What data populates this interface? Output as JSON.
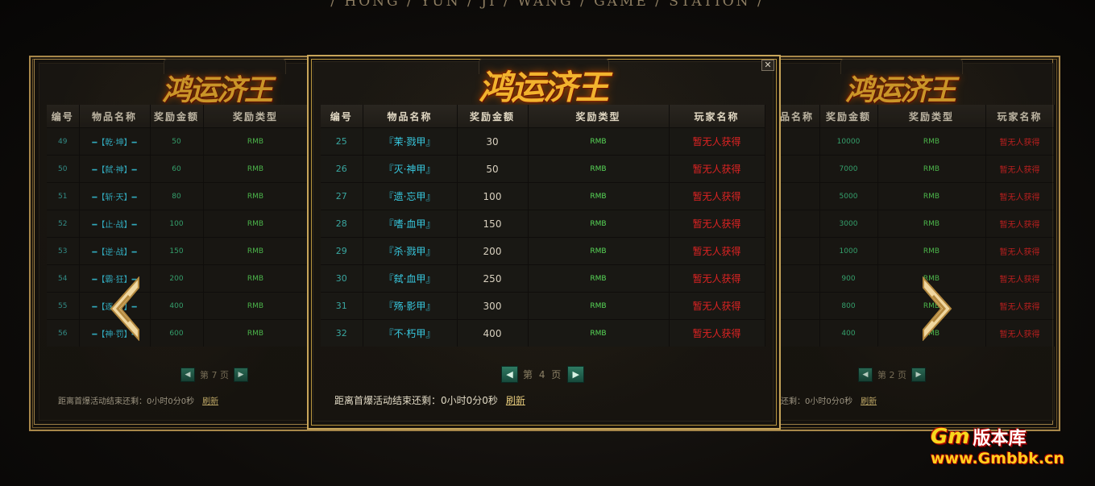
{
  "subtitle": "/ HONG / YUN / JI / WANG / GAME / STATION /",
  "logo_text": "鸿运济王",
  "watermark": {
    "brand": "Gm版本库",
    "brand_gm": "Gm",
    "brand_cn": "版本库",
    "url": "www.Gmbbk.cn"
  },
  "colors": {
    "gold": "#c7a55a",
    "num": "#39a6a0",
    "item": "#38c9e0",
    "type": "#58d858",
    "player": "#e02323"
  },
  "icons": {
    "prev": "chevron-left-icon",
    "next": "chevron-right-icon",
    "close": "close-icon"
  },
  "left_panel": {
    "headers": {
      "num": "编号",
      "item": "物品名称",
      "amount": "奖励金额",
      "type": "奖励类型"
    },
    "rows": [
      {
        "num": "49",
        "item": "━【乾·坤】━",
        "amount": "50",
        "type": "RMB"
      },
      {
        "num": "50",
        "item": "━【弑·神】━",
        "amount": "60",
        "type": "RMB"
      },
      {
        "num": "51",
        "item": "━【斩·天】━",
        "amount": "80",
        "type": "RMB"
      },
      {
        "num": "52",
        "item": "━【止·战】━",
        "amount": "100",
        "type": "RMB"
      },
      {
        "num": "53",
        "item": "━【逆·战】━",
        "amount": "150",
        "type": "RMB"
      },
      {
        "num": "54",
        "item": "━【霸·狂】━",
        "amount": "200",
        "type": "RMB"
      },
      {
        "num": "55",
        "item": "━【逐·日】━",
        "amount": "400",
        "type": "RMB"
      },
      {
        "num": "56",
        "item": "━【神·罚】━",
        "amount": "600",
        "type": "RMB"
      }
    ],
    "page": "第 7 页",
    "timer": "距离首爆活动结束还剩：0小时0分0秒",
    "refresh": "刷新"
  },
  "center_panel": {
    "headers": {
      "num": "编号",
      "item": "物品名称",
      "amount": "奖励金额",
      "type": "奖励类型",
      "player": "玩家名称"
    },
    "rows": [
      {
        "num": "25",
        "item": "『茉·戮甲』",
        "amount": "30",
        "type": "RMB",
        "player": "暂无人获得"
      },
      {
        "num": "26",
        "item": "『灭·神甲』",
        "amount": "50",
        "type": "RMB",
        "player": "暂无人获得"
      },
      {
        "num": "27",
        "item": "『遗·忘甲』",
        "amount": "100",
        "type": "RMB",
        "player": "暂无人获得"
      },
      {
        "num": "28",
        "item": "『嗜·血甲』",
        "amount": "150",
        "type": "RMB",
        "player": "暂无人获得"
      },
      {
        "num": "29",
        "item": "『杀·戮甲』",
        "amount": "200",
        "type": "RMB",
        "player": "暂无人获得"
      },
      {
        "num": "30",
        "item": "『弑·血甲』",
        "amount": "250",
        "type": "RMB",
        "player": "暂无人获得"
      },
      {
        "num": "31",
        "item": "『殇·影甲』",
        "amount": "300",
        "type": "RMB",
        "player": "暂无人获得"
      },
      {
        "num": "32",
        "item": "『不·朽甲』",
        "amount": "400",
        "type": "RMB",
        "player": "暂无人获得"
      }
    ],
    "page": "第 4 页",
    "timer": "距离首爆活动结束还剩：0小时0分0秒",
    "refresh": "刷新"
  },
  "right_panel": {
    "headers": {
      "item": "品名称",
      "amount": "奖励金额",
      "type": "奖励类型",
      "player": "玩家名称"
    },
    "rows": [
      {
        "amount": "10000",
        "type": "RMB",
        "player": "暂无人获得"
      },
      {
        "amount": "7000",
        "type": "RMB",
        "player": "暂无人获得"
      },
      {
        "amount": "5000",
        "type": "RMB",
        "player": "暂无人获得"
      },
      {
        "amount": "3000",
        "type": "RMB",
        "player": "暂无人获得"
      },
      {
        "amount": "1000",
        "type": "RMB",
        "player": "暂无人获得"
      },
      {
        "amount": "900",
        "type": "RMB",
        "player": "暂无人获得"
      },
      {
        "amount": "800",
        "type": "RMB",
        "player": "暂无人获得"
      },
      {
        "amount": "400",
        "type": "RMB",
        "player": "暂无人获得"
      }
    ],
    "page": "第 2 页",
    "timer": "还剩：0小时0分0秒",
    "refresh": "刷新"
  }
}
